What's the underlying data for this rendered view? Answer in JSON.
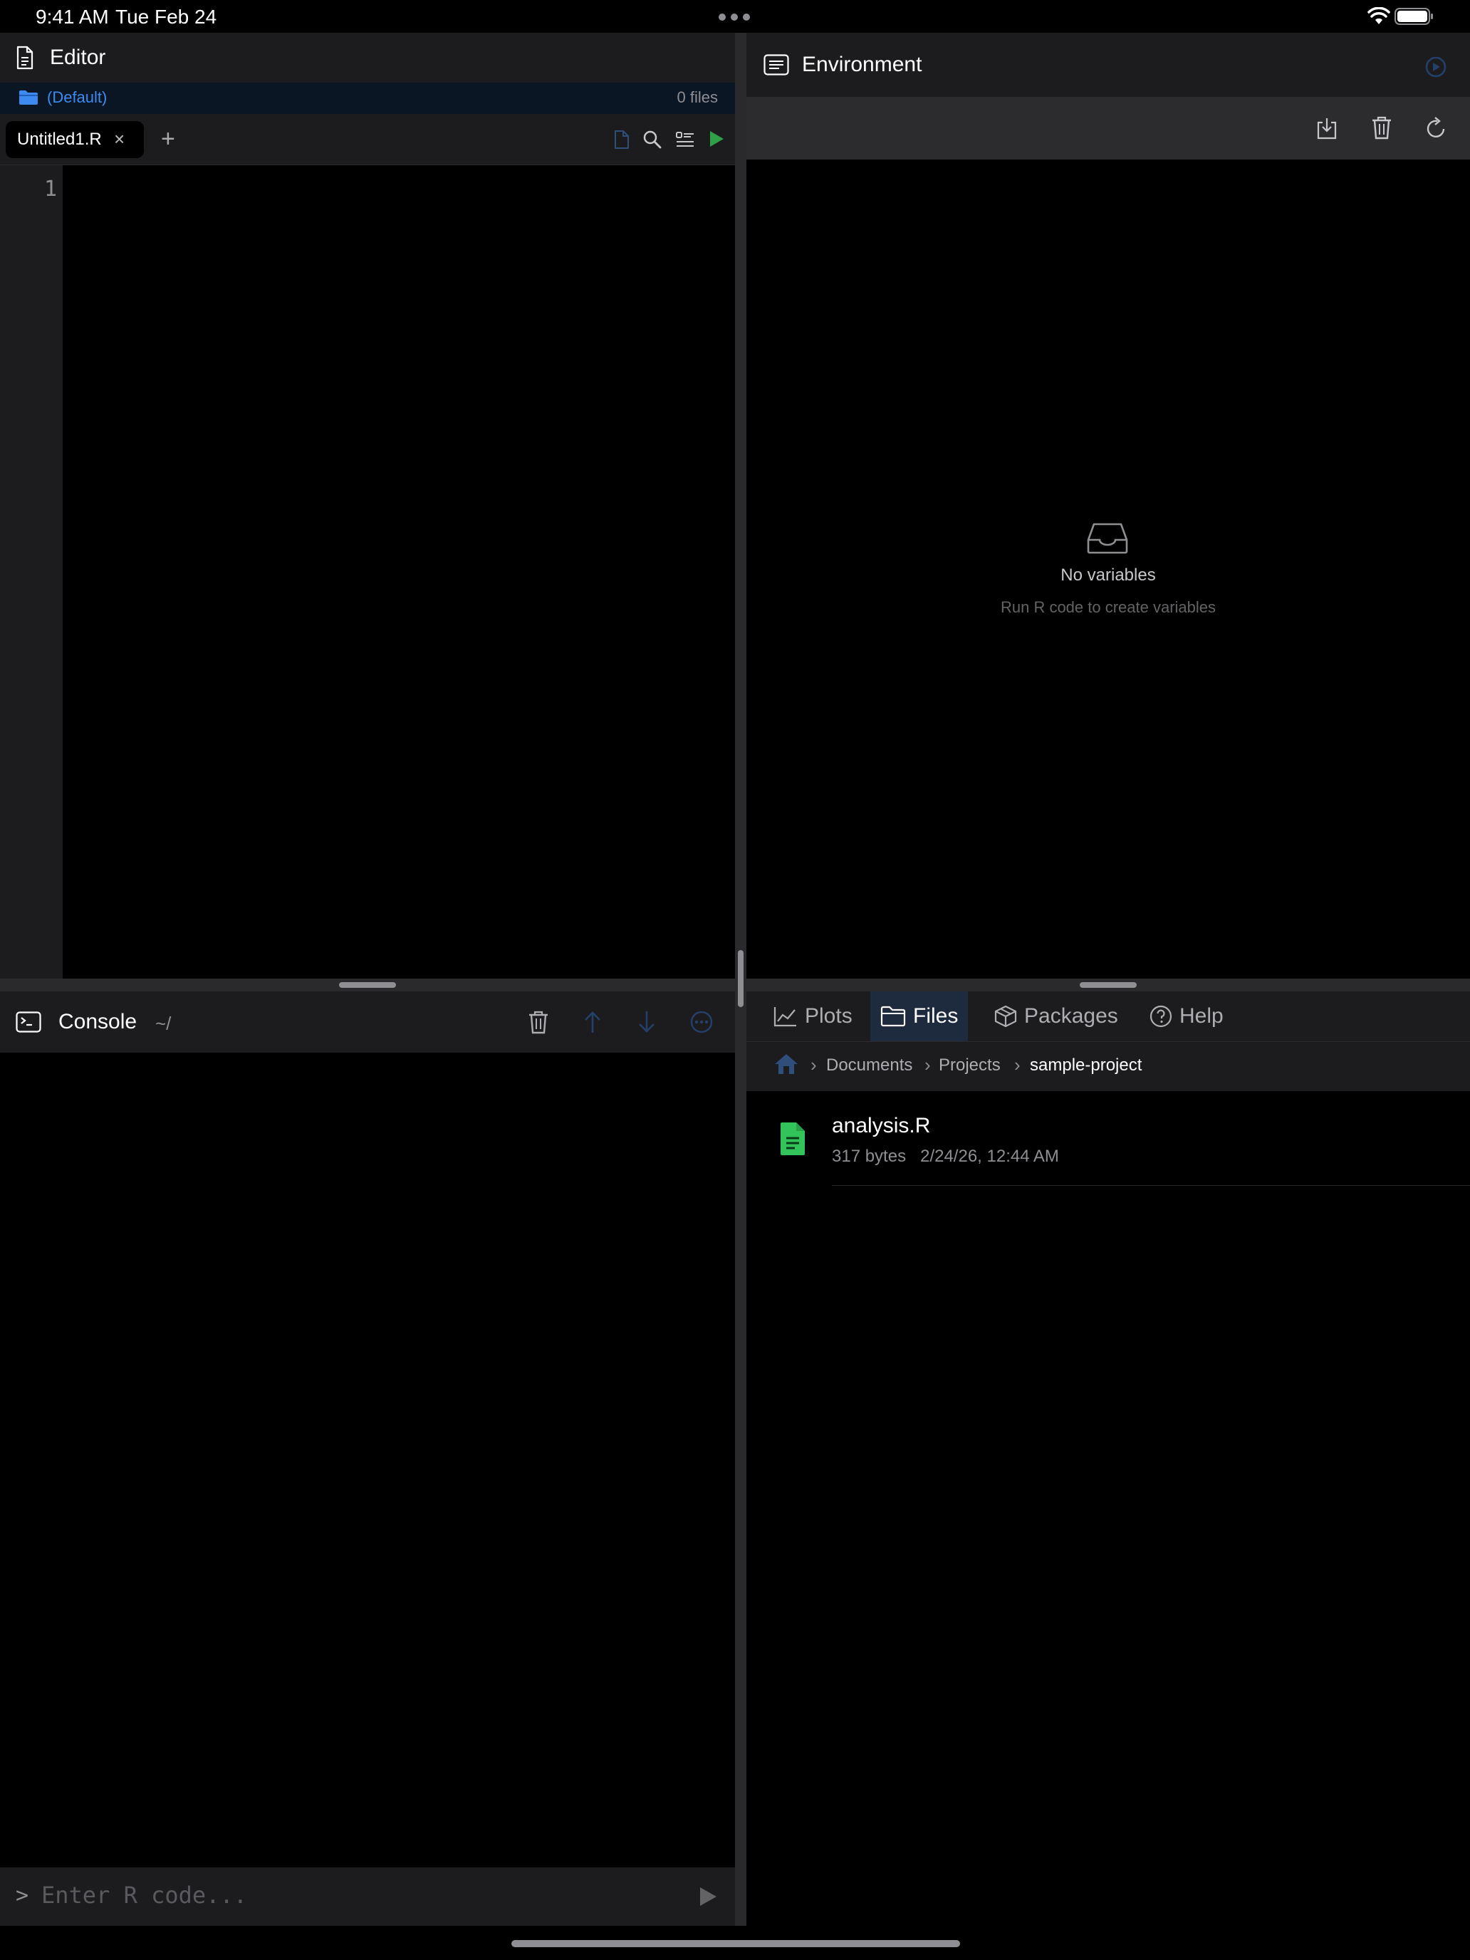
{
  "status_bar": {
    "time": "9:41 AM",
    "date": "Tue Feb 24"
  },
  "editor": {
    "title": "Editor",
    "project": "(Default)",
    "file_count": "0 files",
    "tabs": [
      {
        "label": "Untitled1.R",
        "close": "×"
      }
    ],
    "add_tab": "+",
    "line_numbers": [
      "1"
    ]
  },
  "console": {
    "title": "Console",
    "path": "~/",
    "prompt": ">",
    "input_placeholder": "Enter R code...",
    "input_value": ""
  },
  "environment": {
    "title": "Environment",
    "empty_title": "No variables",
    "empty_subtitle": "Run R code to create variables"
  },
  "bottom_panel": {
    "tabs": [
      {
        "label": "Plots",
        "icon": "chart-line-icon"
      },
      {
        "label": "Files",
        "icon": "folder-icon",
        "active": true
      },
      {
        "label": "Packages",
        "icon": "box-icon"
      },
      {
        "label": "Help",
        "icon": "question-circle-icon"
      }
    ],
    "breadcrumb": [
      "Documents",
      "Projects",
      "sample-project"
    ],
    "files": [
      {
        "name": "analysis.R",
        "size": "317 bytes",
        "modified": "2/24/26, 12:44 AM"
      }
    ]
  },
  "colors": {
    "accent": "#3d8bf2",
    "run_green": "#30a046",
    "file_green": "#32c45a",
    "panel_bg": "#1c1c1e",
    "toolbar_bg": "#2c2c2e"
  }
}
